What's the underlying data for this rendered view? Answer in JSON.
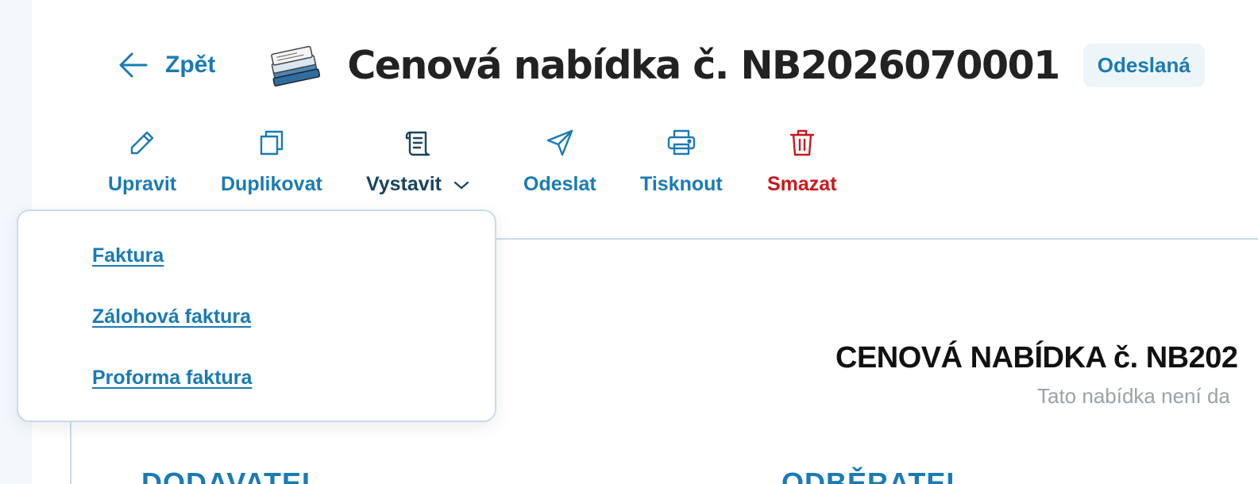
{
  "header": {
    "back_label": "Zpět",
    "title": "Cenová nabídka č. NB2026070001",
    "status": "Odeslaná"
  },
  "toolbar": {
    "edit": "Upravit",
    "duplicate": "Duplikovat",
    "issue": "Vystavit",
    "send": "Odeslat",
    "print": "Tisknout",
    "delete": "Smazat"
  },
  "issue_menu": {
    "items": [
      "Faktura",
      "Zálohová faktura",
      "Proforma faktura"
    ]
  },
  "document": {
    "heading": "CENOVÁ NABÍDKA č. NB202",
    "note": "Tato nabídka není da",
    "supplier_label": "DODAVATEL",
    "customer_label": "ODBĚRATEL"
  },
  "colors": {
    "accent": "#1a7bb5",
    "danger": "#c9191c",
    "active": "#17445f",
    "border": "#c7dde9"
  },
  "icons": {
    "edit": "pencil-icon",
    "duplicate": "copy-icon",
    "issue": "scroll-icon",
    "send": "paper-plane-icon",
    "print": "printer-icon",
    "delete": "trash-icon"
  }
}
